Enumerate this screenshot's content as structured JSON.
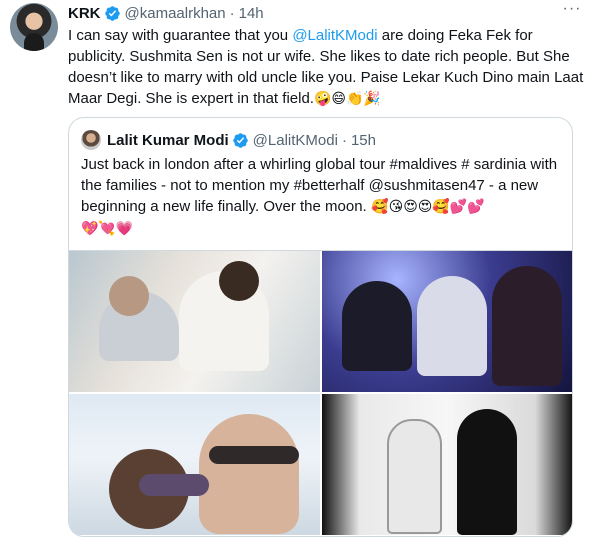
{
  "tweet": {
    "name": "KRK",
    "handle": "@kamaalrkhan",
    "separator": "·",
    "time": "14h",
    "more_label": "···",
    "text_part1": "I can say with guarantee that you ",
    "mention": "@LalitKModi",
    "text_part2": " are doing Feka Fek for publicity. Sushmita Sen is not ur wife. She likes to date rich people. But She doesn’t like to marry with old uncle like you. Paise Lekar Kuch Dino main Laat Maar Degi. She is expert in that field.",
    "emojis": "🤪😄👏🎉"
  },
  "quote": {
    "name": "Lalit Kumar Modi",
    "handle": "@LalitKModi",
    "separator": "·",
    "time": "15h",
    "text": "Just back in london after a whirling global tour #maldives # sardinia with the families - not to mention my #betterhalf @sushmitasen47 - a new beginning a new life finally. Over the moon.",
    "emojis_line1": " 🥰😘😍😍🥰💕💕",
    "emojis_line2": "💖💘💗"
  },
  "colors": {
    "link": "#1d9bf0",
    "verified": "#1d9bf0",
    "secondary_text": "#536471",
    "border": "#cfd9de"
  },
  "icons": {
    "verified": "verified-badge-icon",
    "more": "more-horizontal-icon"
  }
}
